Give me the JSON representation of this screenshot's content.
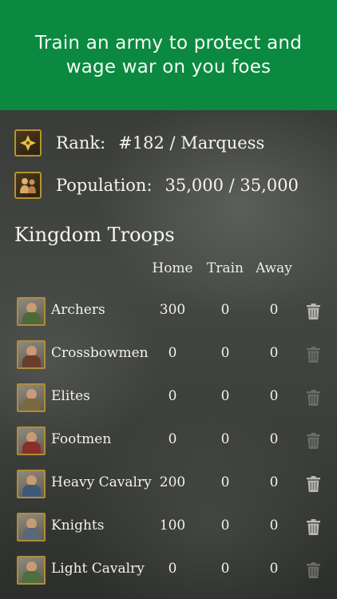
{
  "banner": {
    "text": "Train an army to protect and wage war on you foes"
  },
  "stats": {
    "rank_label": "Rank:",
    "rank_value": "#182 / Marquess",
    "population_label": "Population:",
    "population_value": "35,000 / 35,000"
  },
  "section_title": "Kingdom Troops",
  "columns": {
    "home": "Home",
    "train": "Train",
    "away": "Away"
  },
  "troops": [
    {
      "name": "Archers",
      "home": "300",
      "train": "0",
      "away": "0",
      "delete_enabled": true,
      "icon": "archer-portrait-icon",
      "color": "#4d6a3a"
    },
    {
      "name": "Crossbowmen",
      "home": "0",
      "train": "0",
      "away": "0",
      "delete_enabled": false,
      "icon": "crossbowman-portrait-icon",
      "color": "#6a3d2a"
    },
    {
      "name": "Elites",
      "home": "0",
      "train": "0",
      "away": "0",
      "delete_enabled": false,
      "icon": "elite-portrait-icon",
      "color": "#7a6a44"
    },
    {
      "name": "Footmen",
      "home": "0",
      "train": "0",
      "away": "0",
      "delete_enabled": false,
      "icon": "footman-portrait-icon",
      "color": "#8a2e2a"
    },
    {
      "name": "Heavy Cavalry",
      "home": "200",
      "train": "0",
      "away": "0",
      "delete_enabled": true,
      "icon": "heavy-cavalry-portrait-icon",
      "color": "#3e5a7a"
    },
    {
      "name": "Knights",
      "home": "100",
      "train": "0",
      "away": "0",
      "delete_enabled": true,
      "icon": "knight-portrait-icon",
      "color": "#5a6878"
    },
    {
      "name": "Light Cavalry",
      "home": "0",
      "train": "0",
      "away": "0",
      "delete_enabled": false,
      "icon": "light-cavalry-portrait-icon",
      "color": "#4e6e3e"
    }
  ],
  "colors": {
    "banner_green": "#0b8940",
    "portrait_border": "#b08c3a",
    "trash_enabled": "#b9bab6",
    "trash_disabled": "#6b6d69"
  }
}
